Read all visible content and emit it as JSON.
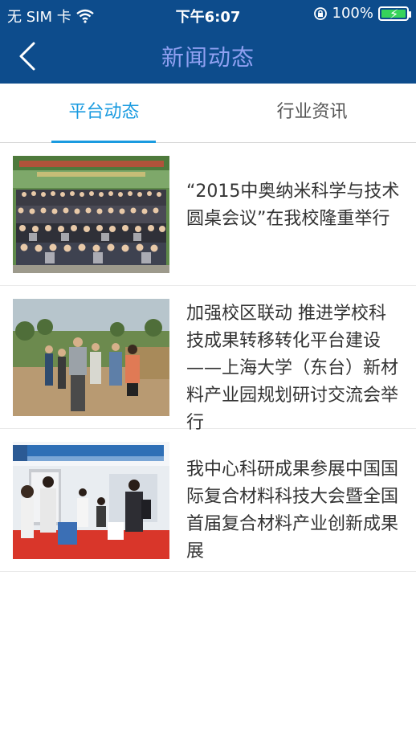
{
  "status_bar": {
    "carrier": "无 SIM 卡",
    "time": "下午6:07",
    "battery_percent": "100%"
  },
  "nav": {
    "title": "新闻动态",
    "back_icon": "chevron-left-icon"
  },
  "tabs": [
    {
      "label": "平台动态",
      "active": true
    },
    {
      "label": "行业资讯",
      "active": false
    }
  ],
  "news": [
    {
      "title": "“2015中奥纳米科学与技术圆桌会议”在我校隆重举行",
      "thumb": "group-photo-image"
    },
    {
      "title": "加强校区联动 推进学校科技成果转移转化平台建设——上海大学（东台）新材料产业园规划研讨交流会举行",
      "thumb": "field-visit-image"
    },
    {
      "title": "我中心科研成果参展中国国际复合材料科技大会暨全国首届复合材料产业创新成果展",
      "thumb": "exhibition-booth-image"
    }
  ],
  "colors": {
    "header_bg": "#0d4c8c",
    "title_text": "#8fa0f1",
    "accent": "#1a9be0",
    "battery": "#36d35b"
  }
}
